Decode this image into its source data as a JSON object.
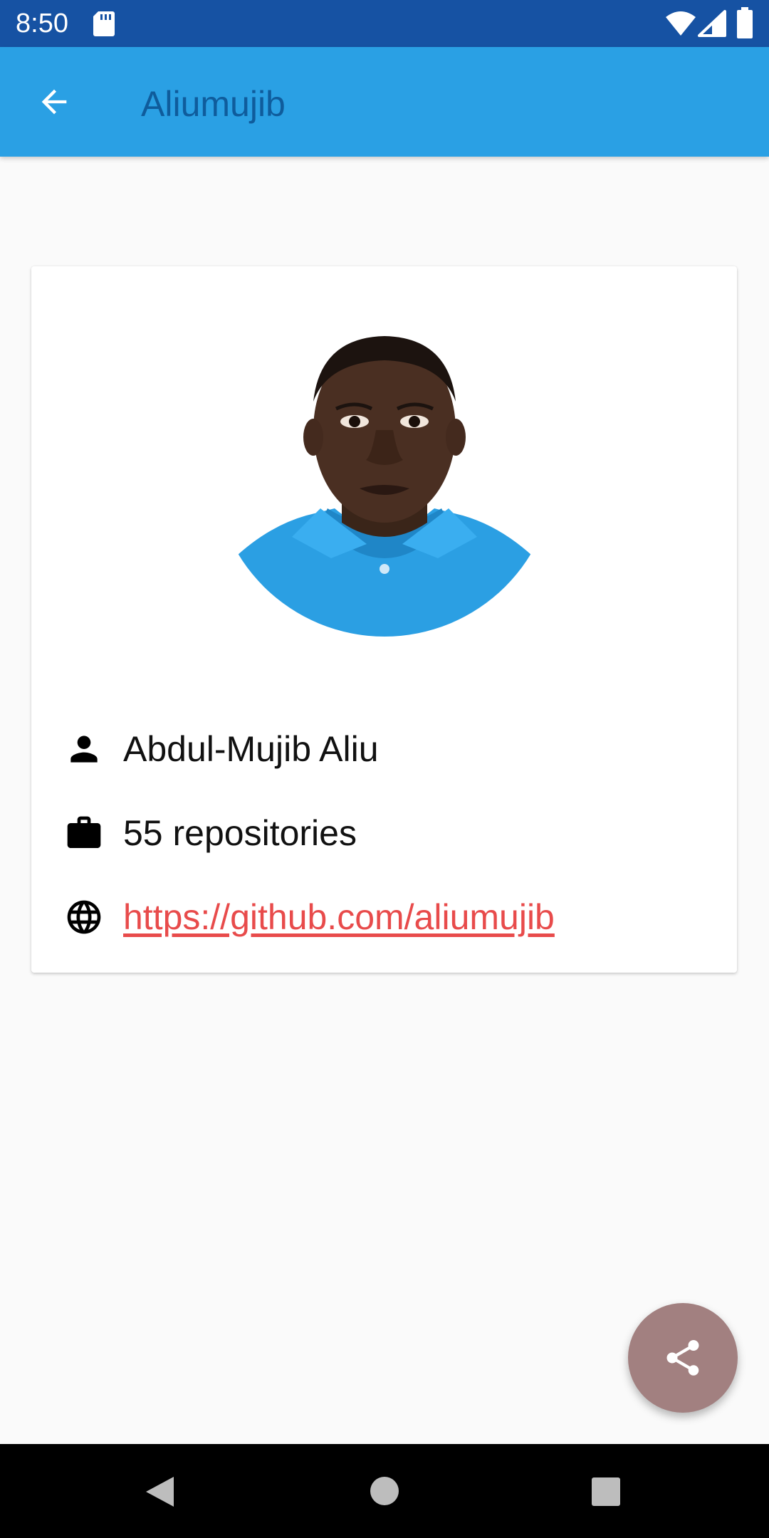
{
  "status_bar": {
    "time": "8:50",
    "icons": [
      "sd-card-icon",
      "wifi-icon",
      "signal-icon",
      "battery-icon"
    ]
  },
  "app_bar": {
    "title": "Aliumujib",
    "back_icon": "arrow-left-icon"
  },
  "profile": {
    "avatar_alt": "profile-photo",
    "name": "Abdul-Mujib Aliu",
    "repositories": "55 repositories",
    "url": "https://github.com/aliumujib",
    "icons": {
      "name": "person-icon",
      "repositories": "briefcase-icon",
      "url": "globe-icon"
    }
  },
  "fab": {
    "icon": "share-icon"
  },
  "nav_bar": {
    "icons": [
      "nav-back-icon",
      "nav-home-icon",
      "nav-recents-icon"
    ]
  },
  "colors": {
    "status_bar": "#1652a3",
    "app_bar": "#2aa0e4",
    "title_text": "#0f5c9c",
    "link": "#e84b4b",
    "fab": "#a28080",
    "background": "#fafafa"
  }
}
